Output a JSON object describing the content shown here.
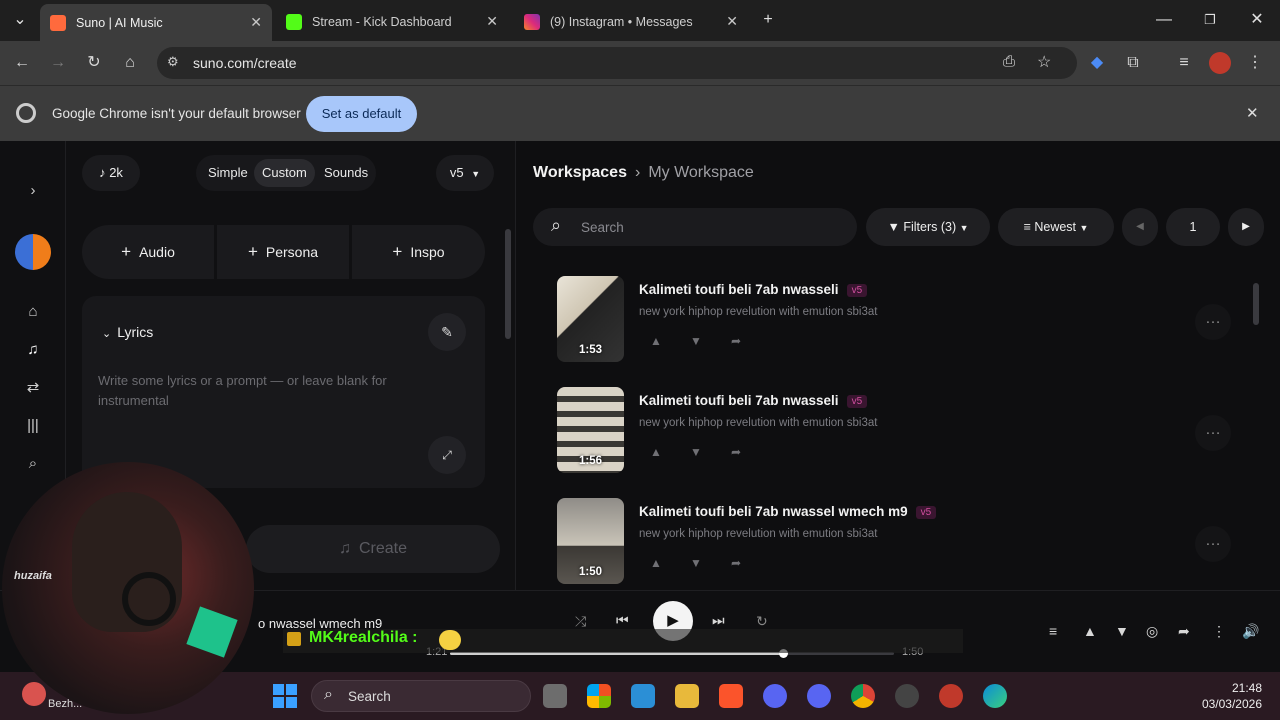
{
  "tabs": [
    {
      "title": "Suno | AI Music",
      "favicon_color": "#ff6a3d"
    },
    {
      "title": "Stream - Kick Dashboard",
      "favicon_color": "#53fc18"
    },
    {
      "title": "(9) Instagram • Messages",
      "favicon_color": "#e1306c"
    }
  ],
  "toolbar": {
    "url": "suno.com/create"
  },
  "infobar": {
    "message": "Google Chrome isn't your default browser",
    "button": "Set as default"
  },
  "left": {
    "credits": "2k",
    "modes": [
      "Simple",
      "Custom",
      "Sounds"
    ],
    "version": "v5",
    "add_buttons": [
      "Audio",
      "Persona",
      "Inspo"
    ],
    "lyrics_title": "Lyrics",
    "lyrics_placeholder": "Write some lyrics or a prompt — or leave blank for instrumental",
    "create_label": "Create"
  },
  "right": {
    "breadcrumb": [
      "Workspaces",
      "My Workspace"
    ],
    "search_placeholder": "Search",
    "filters_label": "Filters (3)",
    "sort_label": "Newest",
    "page": "1",
    "songs": [
      {
        "title": "Kalimeti toufi beli 7ab nwasseli",
        "badge": "v5",
        "desc": "new york hiphop revelution with emution sbi3at",
        "duration": "1:53"
      },
      {
        "title": "Kalimeti toufi beli 7ab nwasseli",
        "badge": "v5",
        "desc": "new york hiphop revelution with emution sbi3at",
        "duration": "1:56"
      },
      {
        "title": "Kalimeti toufi beli 7ab nwassel wmech m9",
        "badge": "v5",
        "desc": "new york hiphop revelution with emution sbi3at",
        "duration": "1:50"
      }
    ]
  },
  "player": {
    "now_playing": "o nwassel wmech m9",
    "elapsed": "1:21",
    "total": "1:50",
    "progress": 0.75
  },
  "overlay": {
    "chat_user": "MK4realchila :",
    "webcam_tag": "huzaifa"
  },
  "taskbar": {
    "search": "Search",
    "time": "21:48",
    "date": "03/03/2026",
    "weather": "Bezh..."
  }
}
